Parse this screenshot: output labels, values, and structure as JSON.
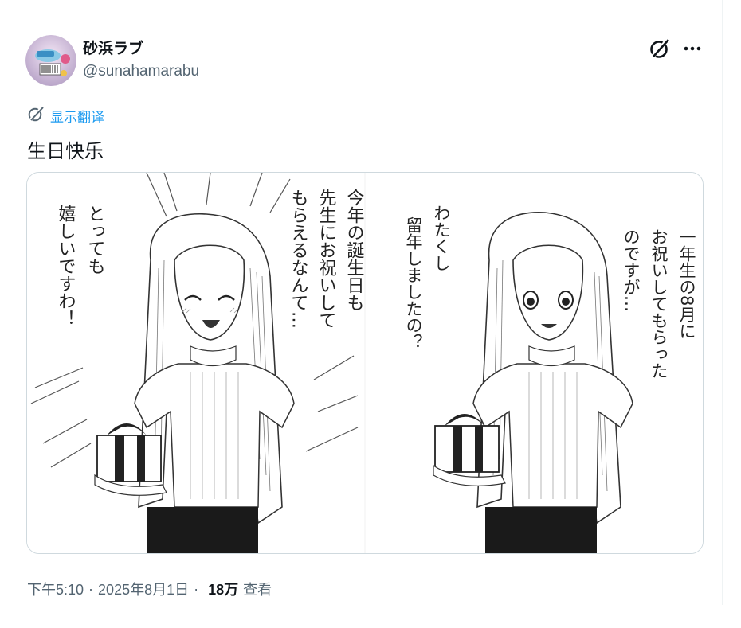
{
  "author": {
    "display_name": "砂浜ラブ",
    "handle": "@sunahamarabu"
  },
  "actions": {
    "grok_icon": "grok-slash-icon",
    "more_icon": "more-horizontal-icon"
  },
  "translate": {
    "label": "显示翻译",
    "icon": "grok-slash-icon"
  },
  "tweet": {
    "text": "生日快乐"
  },
  "media": {
    "panels": [
      {
        "side": "left",
        "speech": [
          "とっても",
          "嬉しいですわ！",
          "今年の誕生日も",
          "先生にお祝いして",
          "もらえるなんて…"
        ]
      },
      {
        "side": "right",
        "speech": [
          "わたくし",
          "留年しましたの？",
          "一年生の8月に",
          "お祝いしてもらった",
          "のですが…"
        ]
      }
    ]
  },
  "meta": {
    "time": "下午5:10",
    "date": "2025年8月1日",
    "separator": "·",
    "views_count": "18万",
    "views_label": "查看"
  },
  "colors": {
    "link_blue": "#1d9bf0",
    "secondary_text": "#536471",
    "primary_text": "#0f1419",
    "border": "#cfd9de"
  }
}
